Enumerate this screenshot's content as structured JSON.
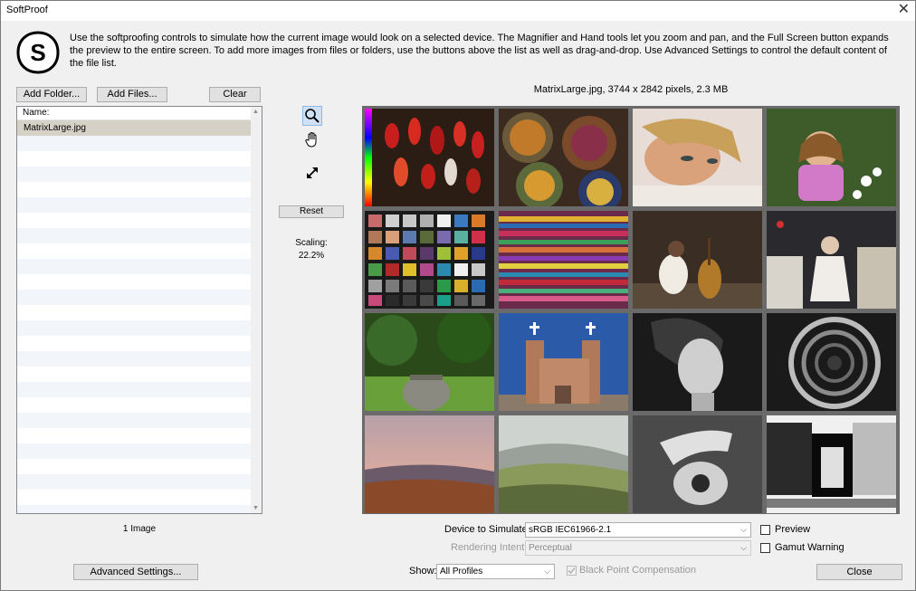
{
  "window": {
    "title": "SoftProof",
    "close_glyph": "✕"
  },
  "intro_text": "Use the softproofing controls to simulate how the current image would look on a selected device. The Magnifier and Hand tools let you zoom and pan, and the Full Screen button expands the preview to the entire screen. To add more images from files or folders, use the buttons above the list as well as drag-and-drop. Use Advanced Settings to control the default content of the file list.",
  "logo_letter": "S",
  "file_buttons": {
    "add_folder": "Add Folder...",
    "add_files": "Add Files...",
    "clear": "Clear"
  },
  "file_list": {
    "header": "Name:",
    "items": [
      "MatrixLarge.jpg"
    ],
    "count_label": "1 Image"
  },
  "tools": {
    "magnifier": "magnifier-icon",
    "hand": "hand-icon",
    "fullscreen": "fullscreen-icon",
    "reset_label": "Reset"
  },
  "scaling": {
    "label": "Scaling:",
    "value": "22.2%"
  },
  "image_info": "MatrixLarge.jpg, 3744 x 2842 pixels, 2.3 MB",
  "device": {
    "label": "Device to Simulate:",
    "value": "sRGB IEC61966-2.1"
  },
  "rendering_intent": {
    "label": "Rendering Intent:",
    "value": "Perceptual"
  },
  "show": {
    "label": "Show:",
    "value": "All Profiles"
  },
  "black_point": {
    "label": "Black Point Compensation",
    "checked": true
  },
  "checkboxes": {
    "preview": "Preview",
    "gamut_warning": "Gamut Warning"
  },
  "advanced_settings": "Advanced Settings...",
  "close_button": "Close"
}
